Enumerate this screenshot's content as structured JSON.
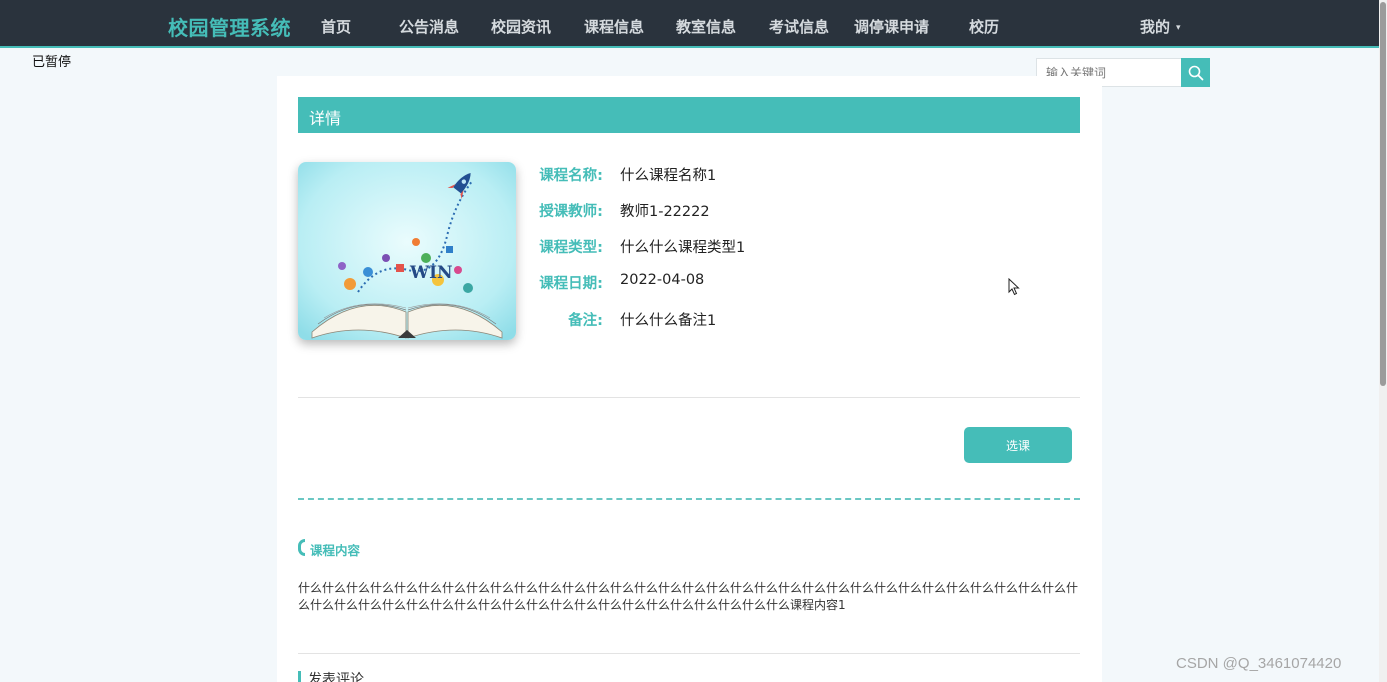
{
  "header": {
    "brand": "校园管理系统",
    "nav": [
      {
        "label": "首页"
      },
      {
        "label": "公告消息"
      },
      {
        "label": "校园资讯"
      },
      {
        "label": "课程信息"
      },
      {
        "label": "教室信息"
      },
      {
        "label": "考试信息"
      },
      {
        "label": "调停课申请"
      },
      {
        "label": "校历"
      }
    ],
    "mine_label": "我的",
    "mine_caret": "▾"
  },
  "status_overlay": "已暂停",
  "search": {
    "placeholder": "输入关键词",
    "value": ""
  },
  "detail": {
    "heading": "详情",
    "fields": [
      {
        "label": "课程名称:",
        "value": "什么课程名称1"
      },
      {
        "label": "授课教师:",
        "value": "教师1-22222"
      },
      {
        "label": "课程类型:",
        "value": "什么什么课程类型1"
      },
      {
        "label": "课程日期:",
        "value": "2022-04-08"
      },
      {
        "label": "备注:",
        "value": "什么什么备注1"
      }
    ],
    "cover_text": "WIN",
    "select_button": "选课"
  },
  "course_content": {
    "title": "课程内容",
    "text": "什么什么什么什么什么什么什么什么什么什么什么什么什么什么什么什么什么什么什么什么什么什么什么什么什么什么什么什么什么什么什么什么什么什么什么什么什么什么什么什么什么什么什么什么什么什么什么什么什么什么什么什么什么课程内容1"
  },
  "comment": {
    "title": "发表评论"
  },
  "watermark": "CSDN @Q_3461074420",
  "colors": {
    "accent": "#45bdb8",
    "topbar": "#2a333d",
    "page_bg": "#f3f8fb"
  }
}
